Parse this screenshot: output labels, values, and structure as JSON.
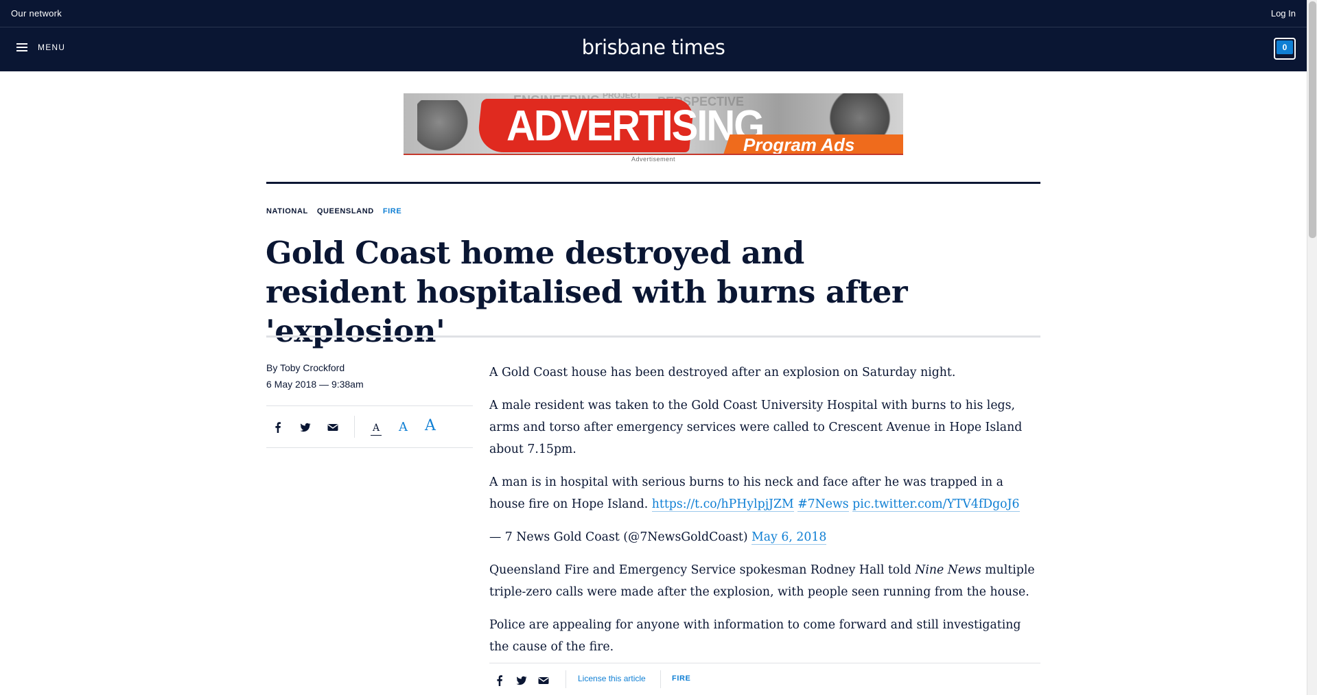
{
  "network_bar": {
    "left_label": "Our network",
    "right_label": "Log In"
  },
  "masthead": {
    "menu_label": "MENU",
    "logo_text": "brisbane times",
    "cart_count": "0"
  },
  "ad": {
    "main_text": "ADVERTISING",
    "sub_text": "Program Ads",
    "label": "Advertisement"
  },
  "breadcrumbs": [
    {
      "label": "NATIONAL"
    },
    {
      "label": "QUEENSLAND"
    },
    {
      "label": "FIRE"
    }
  ],
  "headline": "Gold Coast home destroyed and resident hospitalised with burns after 'explosion'",
  "byline": {
    "author": "By Toby Crockford",
    "date": "6 May 2018 — 9:38am"
  },
  "share": {
    "icons": [
      "facebook-icon",
      "twitter-icon",
      "email-icon"
    ],
    "font_sizes": [
      "A",
      "A",
      "A"
    ]
  },
  "body": {
    "p1": "A Gold Coast house has been destroyed after an explosion on Saturday night.",
    "p2": "A male resident was taken to the Gold Coast University Hospital with burns to his legs, arms and torso after emergency services were called to Crescent Avenue in Hope Island about 7.15pm.",
    "tweet_text": "A man is in hospital with serious burns to his neck and face after he was trapped in a house fire on Hope Island. ",
    "tweet_link1": "https://t.co/hPHylpjJZM",
    "tweet_link2": "#7News",
    "tweet_link3": "pic.twitter.com/YTV4fDgoJ6",
    "tweet_attrib": "— 7 News Gold Coast (@7NewsGoldCoast) ",
    "tweet_date": "May 6, 2018",
    "p4_start": "Queensland Fire and Emergency Service spokesman Rodney Hall told ",
    "p4_em": "Nine News",
    "p4_end": " multiple triple-zero calls were made after the explosion, with people seen running from the house.",
    "p5": "Police are appealing for anyone with information to come forward and still investigating the cause of the fire."
  },
  "footer": {
    "license_label": "License this article",
    "tag_label": "FIRE"
  },
  "colors": {
    "navy": "#0a1633",
    "accent_blue": "#0f7fd4",
    "rule_grey": "#dfe1e5"
  }
}
